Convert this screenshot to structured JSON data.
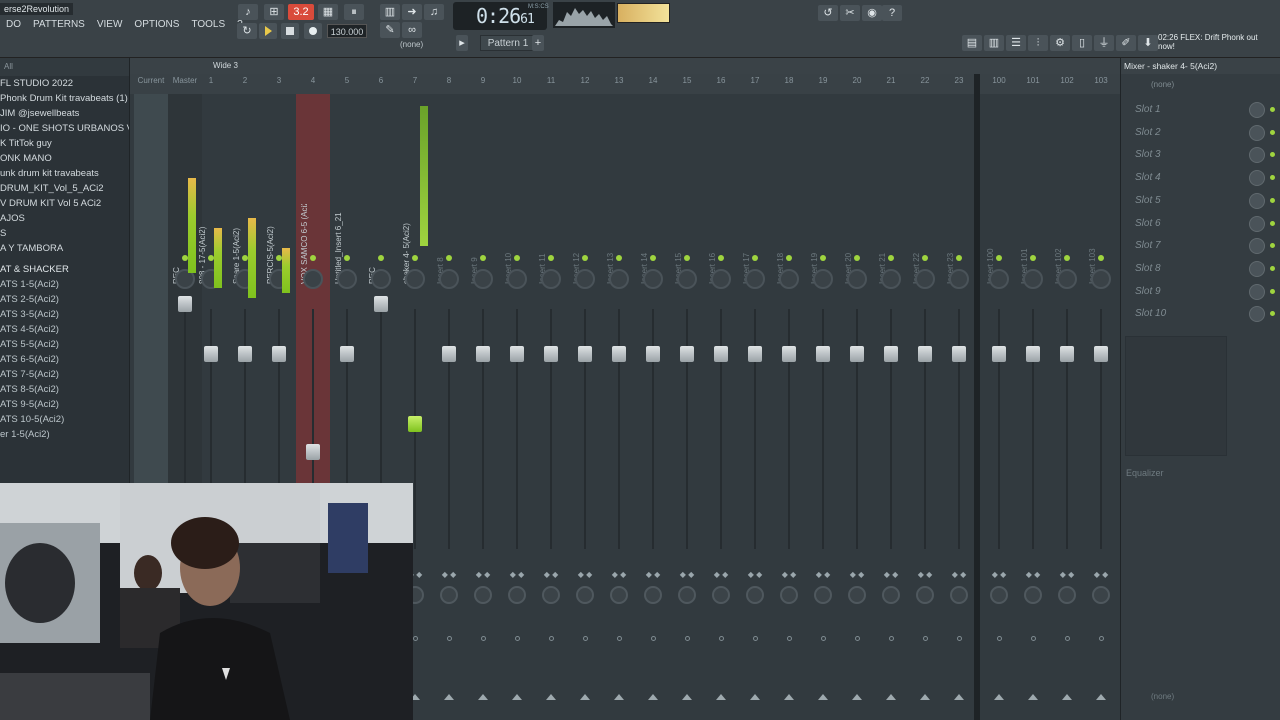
{
  "title_bar": {
    "project": "erse2Revolution"
  },
  "menus": [
    "DO",
    "PATTERNS",
    "VIEW",
    "OPTIONS",
    "TOOLS",
    "?"
  ],
  "transport": {
    "pattern_display": "3.2",
    "tempo": "130.000",
    "time": "0:26",
    "time_sub": "61",
    "time_unit": "M:S:CS",
    "pattern": "Pattern 1",
    "none_label": "(none)"
  },
  "hint": {
    "text": "02:26  FLEX: Drift Phonk out now!"
  },
  "browser": {
    "header": "All",
    "items": [
      {
        "label": "FL STUDIO 2022",
        "kind": "head"
      },
      {
        "label": "Phonk Drum Kit travabeats (1)",
        "kind": "item"
      },
      {
        "label": "JIM @jsewellbeats",
        "kind": "item"
      },
      {
        "label": "IO - ONE SHOTS URBANOS VOL. 2",
        "kind": "item"
      },
      {
        "label": "K TitTok guy",
        "kind": "item"
      },
      {
        "label": "ONK MANO",
        "kind": "item"
      },
      {
        "label": "unk drum kit travabeats",
        "kind": "item"
      },
      {
        "label": "DRUM_KIT_Vol_5_ACi2",
        "kind": "item"
      },
      {
        "label": "V DRUM KIT Vol 5 ACi2",
        "kind": "item"
      },
      {
        "label": "AJOS",
        "kind": "item"
      },
      {
        "label": "S",
        "kind": "item"
      },
      {
        "label": "A Y TAMBORA",
        "kind": "item"
      },
      {
        "label": "AT & SHACKER",
        "kind": "sect"
      },
      {
        "label": "ATS 1-5(Aci2)",
        "kind": "sub"
      },
      {
        "label": "ATS 2-5(Aci2)",
        "kind": "sub"
      },
      {
        "label": "ATS 3-5(Aci2)",
        "kind": "sub"
      },
      {
        "label": "ATS 4-5(Aci2)",
        "kind": "sub"
      },
      {
        "label": "ATS 5-5(Aci2)",
        "kind": "sub"
      },
      {
        "label": "ATS 6-5(Aci2)",
        "kind": "sub"
      },
      {
        "label": "ATS 7-5(Aci2)",
        "kind": "sub"
      },
      {
        "label": "ATS 8-5(Aci2)",
        "kind": "sub"
      },
      {
        "label": "ATS 9-5(Aci2)",
        "kind": "sub"
      },
      {
        "label": "ATS 10-5(Aci2)",
        "kind": "sub"
      },
      {
        "label": "er 1-5(Aci2)",
        "kind": "sub"
      }
    ]
  },
  "mixer": {
    "header_label": "Wide 3",
    "tracks": [
      {
        "num": "Current",
        "name": "",
        "kind": "cur"
      },
      {
        "num": "Master",
        "name": "REC",
        "kind": "master"
      },
      {
        "num": "1",
        "name": "808 - 17-5(Aci2)",
        "kind": ""
      },
      {
        "num": "2",
        "name": "Snare 1-5(Aci2)",
        "kind": ""
      },
      {
        "num": "3",
        "name": "PERCIS-5(Aci2)",
        "kind": ""
      },
      {
        "num": "4",
        "name": "VOX SAMCO 6-5 (Aci2)",
        "kind": "sel"
      },
      {
        "num": "5",
        "name": "Untitled_Insert 6_21",
        "kind": ""
      },
      {
        "num": "6",
        "name": "REC",
        "kind": ""
      },
      {
        "num": "7",
        "name": "shaker 4- 5(Aci2)",
        "kind": "active"
      },
      {
        "num": "8",
        "name": "Insert 8",
        "kind": "dim"
      },
      {
        "num": "9",
        "name": "Insert 9",
        "kind": "dim"
      },
      {
        "num": "10",
        "name": "Insert 10",
        "kind": "dim"
      },
      {
        "num": "11",
        "name": "Insert 11",
        "kind": "dim"
      },
      {
        "num": "12",
        "name": "Insert 12",
        "kind": "dim"
      },
      {
        "num": "13",
        "name": "Insert 13",
        "kind": "dim"
      },
      {
        "num": "14",
        "name": "Insert 14",
        "kind": "dim"
      },
      {
        "num": "15",
        "name": "Insert 15",
        "kind": "dim"
      },
      {
        "num": "16",
        "name": "Insert 16",
        "kind": "dim"
      },
      {
        "num": "17",
        "name": "Insert 17",
        "kind": "dim"
      },
      {
        "num": "18",
        "name": "Insert 18",
        "kind": "dim"
      },
      {
        "num": "19",
        "name": "Insert 19",
        "kind": "dim"
      },
      {
        "num": "20",
        "name": "Insert 20",
        "kind": "dim"
      },
      {
        "num": "21",
        "name": "Insert 21",
        "kind": "dim"
      },
      {
        "num": "22",
        "name": "Insert 22",
        "kind": "dim"
      },
      {
        "num": "23",
        "name": "Insert 23",
        "kind": "dim"
      },
      {
        "num": "100",
        "name": "Insert 100",
        "kind": "dim"
      },
      {
        "num": "101",
        "name": "Insert 101",
        "kind": "dim"
      },
      {
        "num": "102",
        "name": "Insert 102",
        "kind": "dim"
      },
      {
        "num": "103",
        "name": "Insert 103",
        "kind": "dim"
      }
    ]
  },
  "fx_panel": {
    "title": "Mixer - shaker 4- 5(Aci2)",
    "none_top": "(none)",
    "slots": [
      "Slot 1",
      "Slot 2",
      "Slot 3",
      "Slot 4",
      "Slot 5",
      "Slot 6",
      "Slot 7",
      "Slot 8",
      "Slot 9",
      "Slot 10"
    ],
    "eq_label": "Equalizer",
    "none_bottom": "(none)"
  },
  "colors": {
    "accent_green": "#9fd43f",
    "selected_red": "#6a3538",
    "pattern_red": "#d94b3b"
  }
}
